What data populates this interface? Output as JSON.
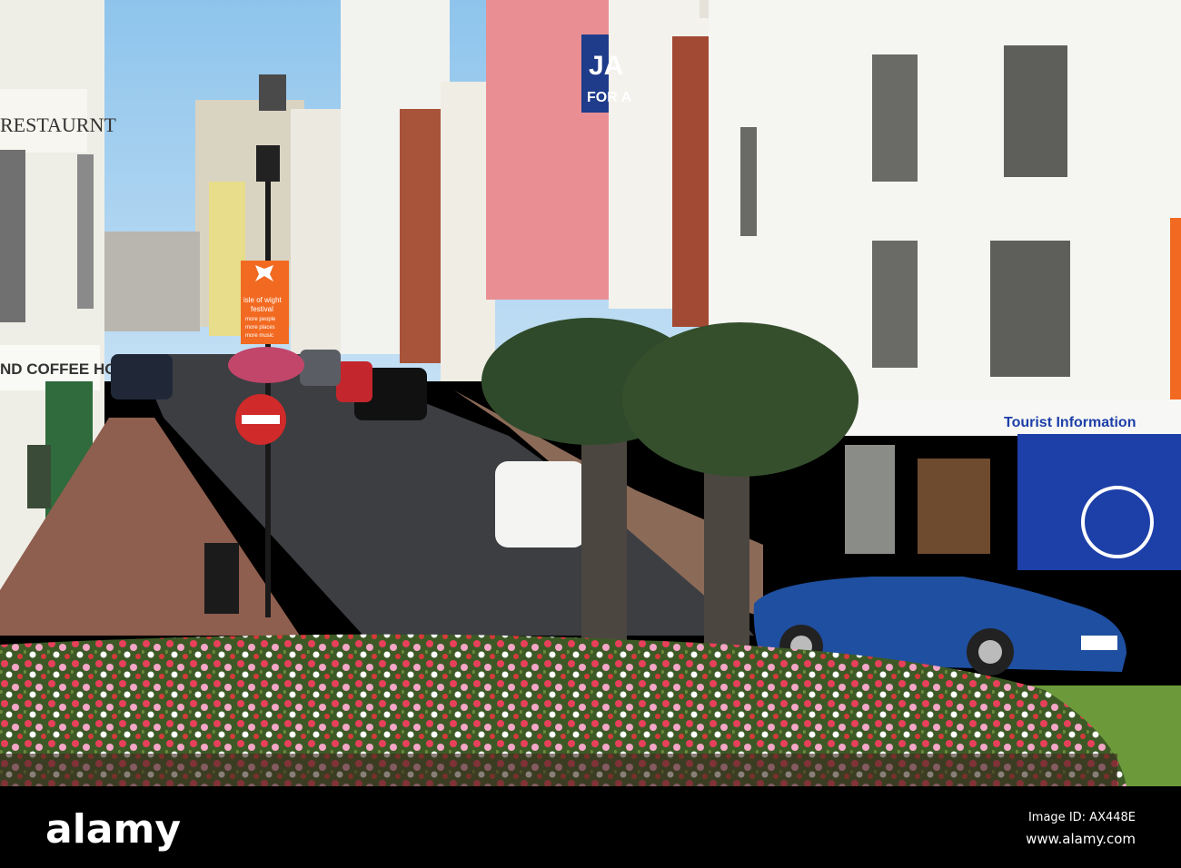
{
  "photo": {
    "signs": {
      "restaurant": "RESTAURNT",
      "coffee_house": "ND COFFEE HO",
      "festival_title_1": "isle of wight",
      "festival_title_2": "festival",
      "festival_line_1": "more people",
      "festival_line_2": "more places",
      "festival_line_3": "more music",
      "blue_sign_1": "JA",
      "blue_sign_2": "FOR A",
      "tourist_info": "Tourist Information"
    },
    "colors": {
      "sky": "#9fcdee",
      "festival_orange": "#f26a21",
      "tourist_blue": "#1d3fa8",
      "car_blue": "#1f4fa0"
    }
  },
  "footer": {
    "logo": "alamy",
    "image_id": "Image ID: AX448E",
    "website": "www.alamy.com"
  }
}
